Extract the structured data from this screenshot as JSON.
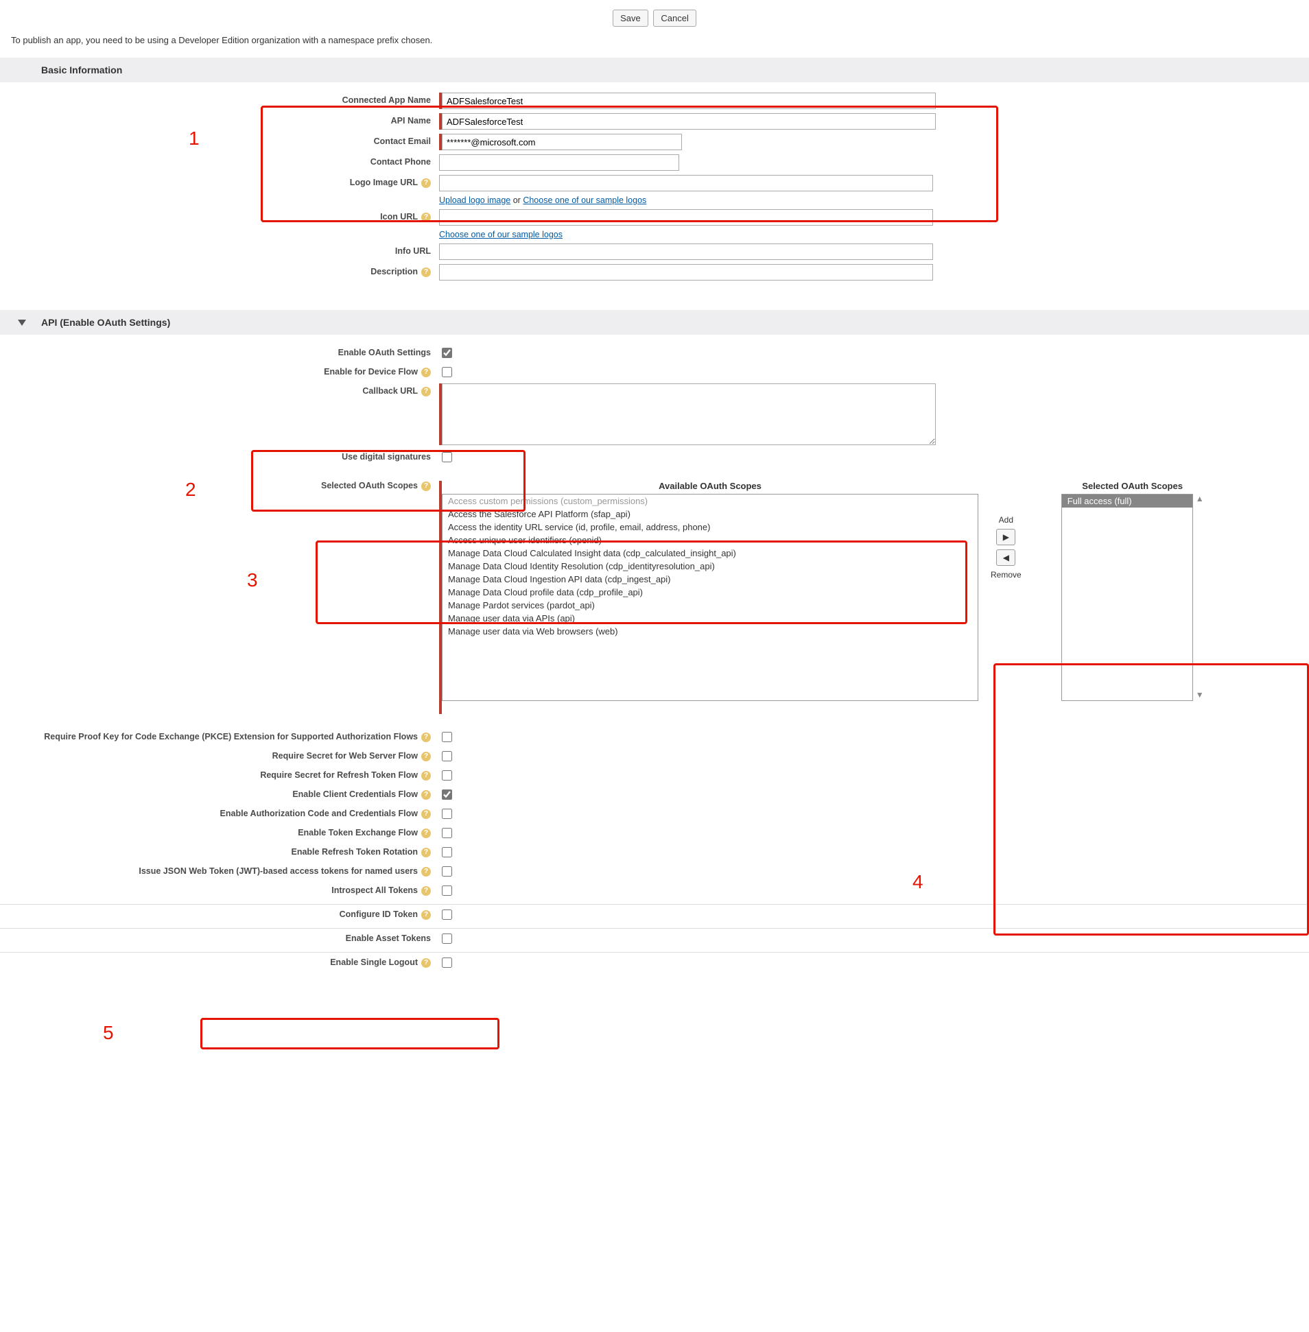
{
  "topbar": {
    "save": "Save",
    "cancel": "Cancel"
  },
  "intro": "To publish an app, you need to be using a Developer Edition organization with a namespace prefix chosen.",
  "annotations": {
    "a1": "1",
    "a2": "2",
    "a3": "3",
    "a4": "4",
    "a5": "5"
  },
  "sections": {
    "basic": "Basic Information",
    "api": "API (Enable OAuth Settings)"
  },
  "basic": {
    "labels": {
      "appname": "Connected App Name",
      "apiname": "API Name",
      "email": "Contact Email",
      "phone": "Contact Phone",
      "logo": "Logo Image URL",
      "icon": "Icon URL",
      "info": "Info URL",
      "desc": "Description"
    },
    "values": {
      "appname": "ADFSalesforceTest",
      "apiname": "ADFSalesforceTest",
      "email": "*******@microsoft.com"
    },
    "hints": {
      "upload_logo": "Upload logo image",
      "or": " or ",
      "choose_sample": "Choose one of our sample logos"
    }
  },
  "api": {
    "labels": {
      "enable_oauth": "Enable OAuth Settings",
      "device_flow": "Enable for Device Flow",
      "callback": "Callback URL",
      "digital_sig": "Use digital signatures",
      "scopes": "Selected OAuth Scopes",
      "pkce": "Require Proof Key for Code Exchange (PKCE) Extension for Supported Authorization Flows",
      "secret_web": "Require Secret for Web Server Flow",
      "secret_refresh": "Require Secret for Refresh Token Flow",
      "client_creds": "Enable Client Credentials Flow",
      "authcode_creds": "Enable Authorization Code and Credentials Flow",
      "token_exch": "Enable Token Exchange Flow",
      "refresh_rot": "Enable Refresh Token Rotation",
      "jwt": "Issue JSON Web Token (JWT)-based access tokens for named users",
      "introspect": "Introspect All Tokens",
      "id_token": "Configure ID Token",
      "asset_token": "Enable Asset Tokens",
      "single_logout": "Enable Single Logout"
    },
    "checks": {
      "enable_oauth": true,
      "device_flow": false,
      "digital_sig": false,
      "pkce": false,
      "secret_web": false,
      "secret_refresh": false,
      "client_creds": true,
      "authcode_creds": false,
      "token_exch": false,
      "refresh_rot": false,
      "jwt": false,
      "introspect": false,
      "id_token": false,
      "asset_token": false,
      "single_logout": false
    }
  },
  "scopes": {
    "titles": {
      "avail": "Available OAuth Scopes",
      "sel": "Selected OAuth Scopes"
    },
    "add": "Add",
    "remove": "Remove",
    "available": [
      "Access custom permissions (custom_permissions)",
      "Access the Salesforce API Platform (sfap_api)",
      "Access the identity URL service (id, profile, email, address, phone)",
      "Access unique user identifiers (openid)",
      "Manage Data Cloud Calculated Insight data (cdp_calculated_insight_api)",
      "Manage Data Cloud Identity Resolution (cdp_identityresolution_api)",
      "Manage Data Cloud Ingestion API data (cdp_ingest_api)",
      "Manage Data Cloud profile data (cdp_profile_api)",
      "Manage Pardot services (pardot_api)",
      "Manage user data via APIs (api)",
      "Manage user data via Web browsers (web)"
    ],
    "selected": [
      "Full access (full)"
    ]
  }
}
